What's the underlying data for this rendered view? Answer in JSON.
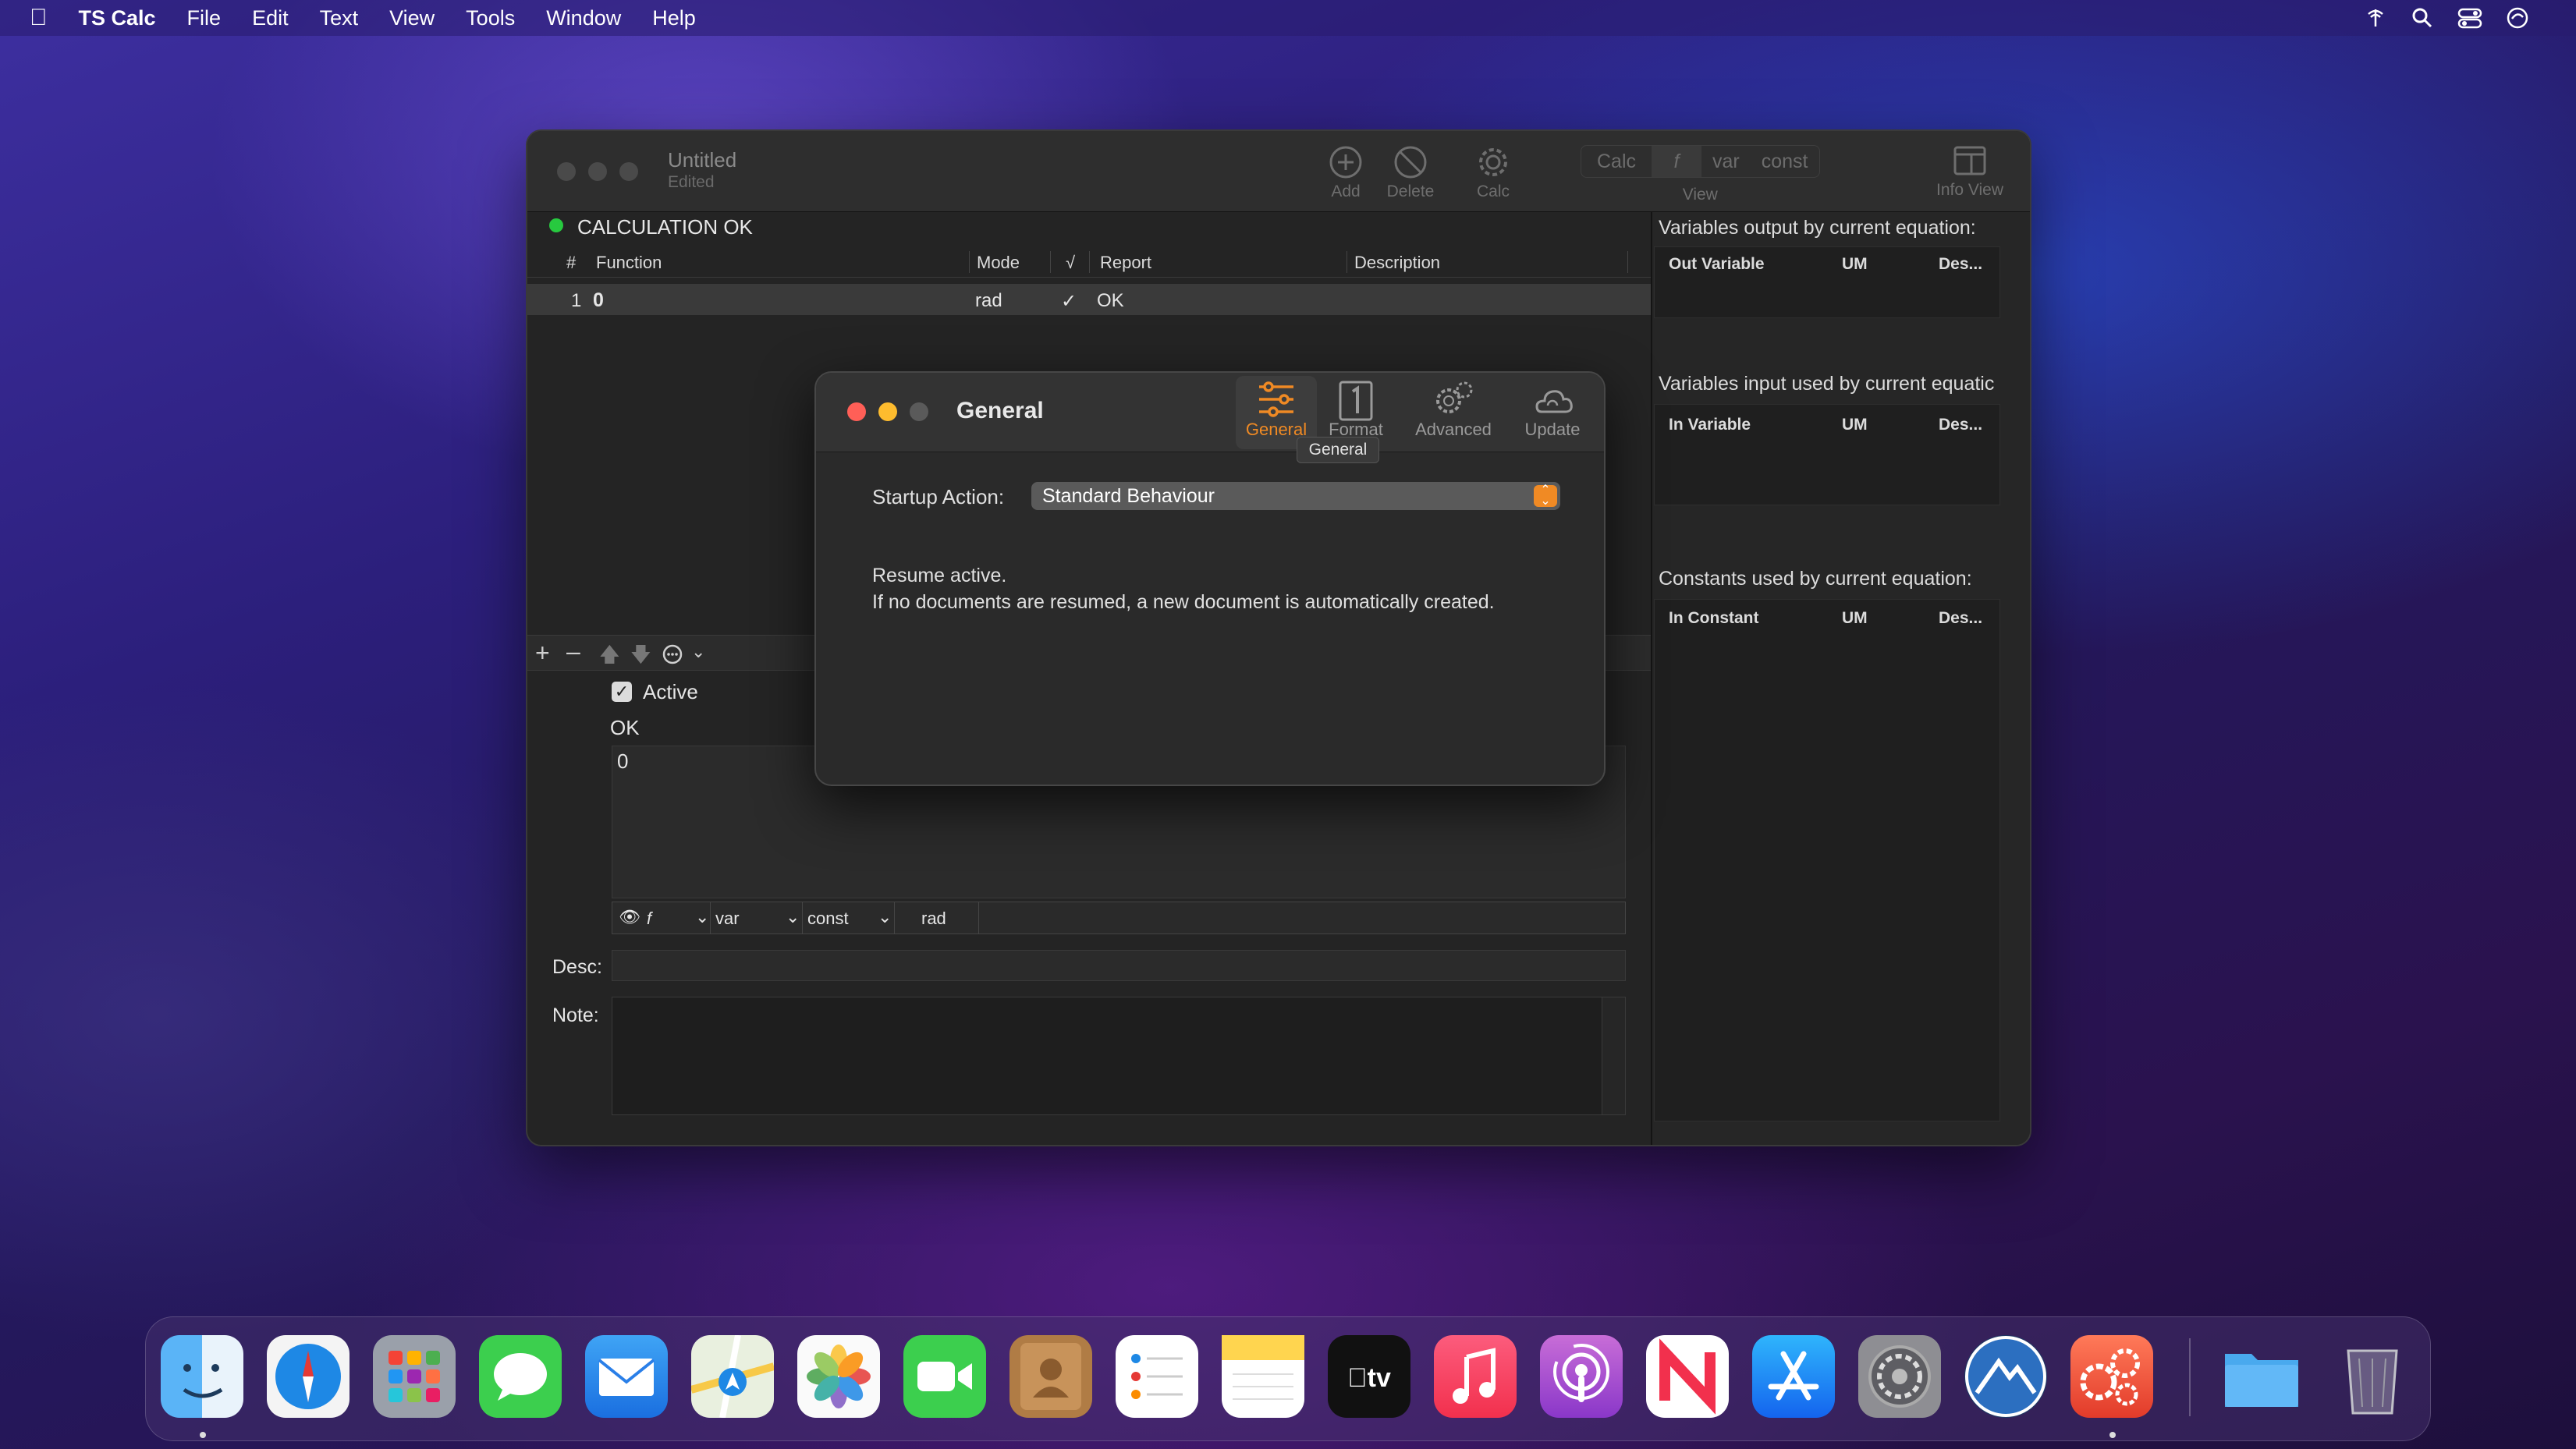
{
  "menubar": {
    "app_name": "TS Calc",
    "items": [
      "File",
      "Edit",
      "Text",
      "View",
      "Tools",
      "Window",
      "Help"
    ]
  },
  "window": {
    "title": "Untitled",
    "subtitle": "Edited",
    "toolbar": {
      "add": "Add",
      "delete": "Delete",
      "calc": "Calc",
      "view_segments": [
        "Calc",
        "f",
        "var",
        "const"
      ],
      "view_label": "View",
      "info_view": "Info View"
    },
    "status": "CALCULATION OK",
    "status_color": "#27c93f",
    "table": {
      "headers": [
        "#",
        "Function",
        "Mode",
        "√",
        "Report",
        "Description"
      ],
      "rows": [
        {
          "num": "1",
          "function": "0",
          "mode": "rad",
          "check": "✓",
          "report": "OK",
          "description": ""
        }
      ]
    },
    "editor": {
      "active_label": "Active",
      "result": "OK",
      "expression": "0",
      "bar": {
        "f": "f",
        "var": "var",
        "const": "const",
        "mode": "rad"
      },
      "desc_label": "Desc:",
      "note_label": "Note:"
    }
  },
  "right_panel": {
    "output_title": "Variables output by current equation:",
    "output_headers": [
      "Out Variable",
      "UM",
      "Des..."
    ],
    "input_title": "Variables input used by current equatic",
    "input_headers": [
      "In Variable",
      "UM",
      "Des..."
    ],
    "const_title": "Constants used by current equation:",
    "const_headers": [
      "In Constant",
      "UM",
      "Des..."
    ]
  },
  "prefs": {
    "title": "General",
    "tabs": [
      "General",
      "Format",
      "Advanced",
      "Update"
    ],
    "tooltip": "General",
    "startup_label": "Startup Action:",
    "startup_value": "Standard Behaviour",
    "resume_line1": "Resume active.",
    "resume_line2": "If no documents are resumed, a new document is automatically created.",
    "accent": "#f08a24"
  },
  "dock": [
    "Finder",
    "Safari",
    "Launchpad",
    "Messages",
    "Mail",
    "Maps",
    "Photos",
    "FaceTime",
    "Contacts",
    "Reminders",
    "Notes",
    "TV",
    "Music",
    "Podcasts",
    "News",
    "App Store",
    "System Preferences",
    "Unknown App",
    "TS Calc",
    "Files",
    "Trash"
  ]
}
